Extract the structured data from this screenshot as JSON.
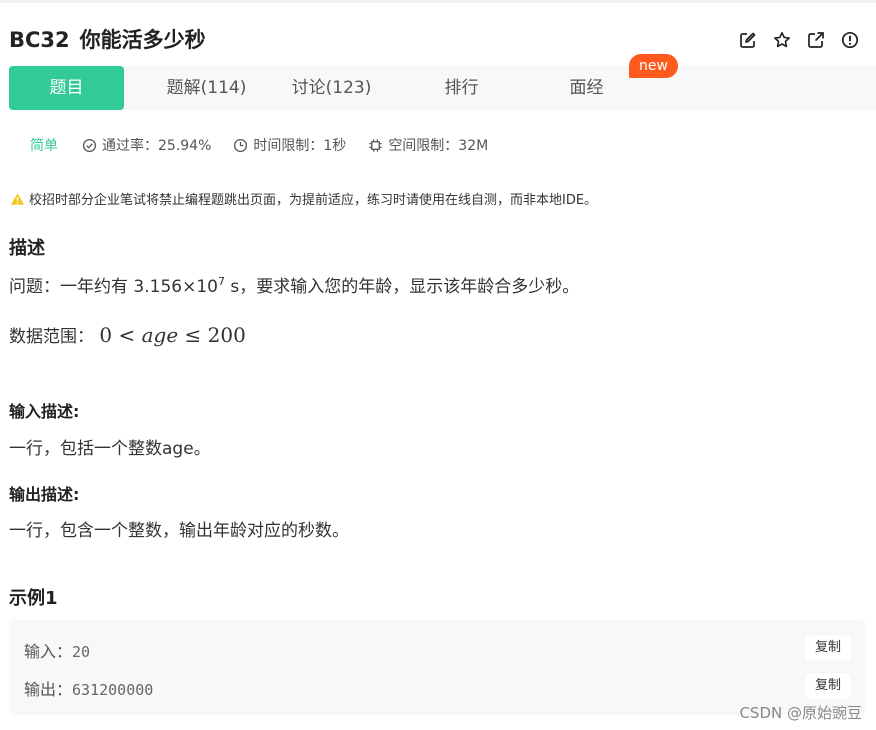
{
  "problem": {
    "code": "BC32",
    "name": "你能活多少秒"
  },
  "header_icons": [
    "edit-icon",
    "star-icon",
    "external-link-icon",
    "report-icon"
  ],
  "tabs": {
    "problem": "题目",
    "solutions": "题解(114)",
    "discuss": "讨论(123)",
    "rank": "排行",
    "interview": "面经",
    "new_badge": "new"
  },
  "meta": {
    "difficulty": "简单",
    "pass_rate": "通过率：25.94%",
    "time_limit": "时间限制：1秒",
    "space_limit": "空间限制：32M"
  },
  "notice": "校招时部分企业笔试将禁止编程题跳出页面，为提前适应，练习时请使用在线自测，而非本地IDE。",
  "description": {
    "heading": "描述",
    "text_prefix": "问题：一年约有 3.156×10",
    "text_exp": "7",
    "text_suffix": " s，要求输入您的年龄，显示该年龄合多少秒。",
    "range_label": "数据范围：",
    "range_lower": "0",
    "range_op1": "<",
    "range_var": "age",
    "range_op2": "≤",
    "range_upper": "200"
  },
  "input_desc": {
    "heading": "输入描述:",
    "text": "一行，包括一个整数age。"
  },
  "output_desc": {
    "heading": "输出描述:",
    "text": "一行，包含一个整数，输出年龄对应的秒数。"
  },
  "example": {
    "heading": "示例1",
    "input_label": "输入：",
    "input_value": "20",
    "output_label": "输出：",
    "output_value": "631200000",
    "copy_label": "复制"
  },
  "watermark": "CSDN @原始豌豆",
  "colors": {
    "accent": "#32ca99",
    "new_badge": "#fe5a1d",
    "warning": "#f5c518"
  }
}
